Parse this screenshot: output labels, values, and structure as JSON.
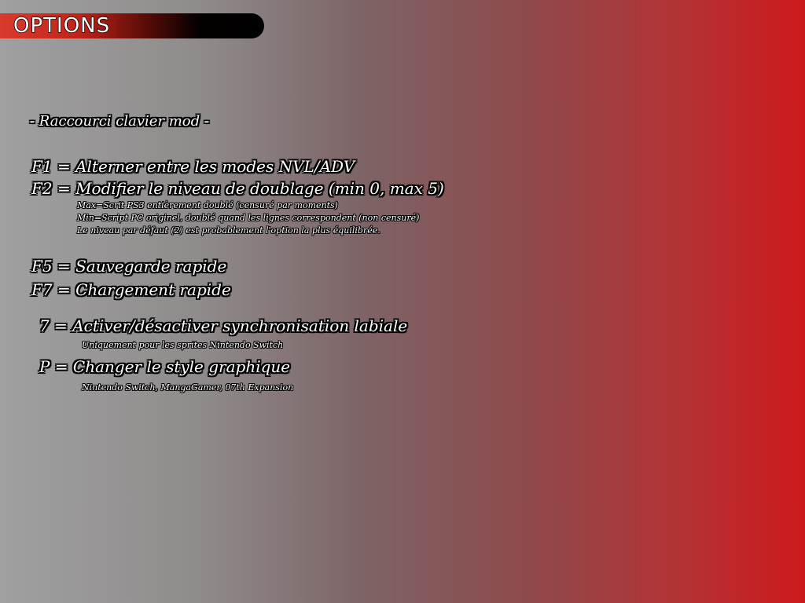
{
  "header": {
    "title": "OPTIONS"
  },
  "shortcuts": {
    "heading": "- Raccourci clavier mod -",
    "f1": "F1 = Alterner entre les modes NVL/ADV",
    "f2": "F2 = Modifier le niveau de doublage (min 0, max 5)",
    "f2_notes": [
      "Max=Scrit PS3 entièrement doublé (censuré par moments)",
      "Min=Script PC originel, doublé quand les lignes correspondent (non censuré)",
      "Le niveau par défaut (2) est probablement l'option la plus équilibrée."
    ],
    "f5": "F5 = Sauvegarde rapide",
    "f7": "F7 = Chargement rapide",
    "key7": "7 = Activer/désactiver synchronisation labiale",
    "key7_note": "Uniquement pour les sprites Nintendo Switch",
    "keyP": "P = Changer le style graphique",
    "keyP_note": "Nintendo Switch, MangaGamer, 07th Expansion"
  },
  "colors": {
    "background_left": "#a0a0a0",
    "background_right": "#cc1a1c",
    "title_bar_red": "#c02419",
    "text": "#ffffff",
    "outline": "#000000"
  }
}
